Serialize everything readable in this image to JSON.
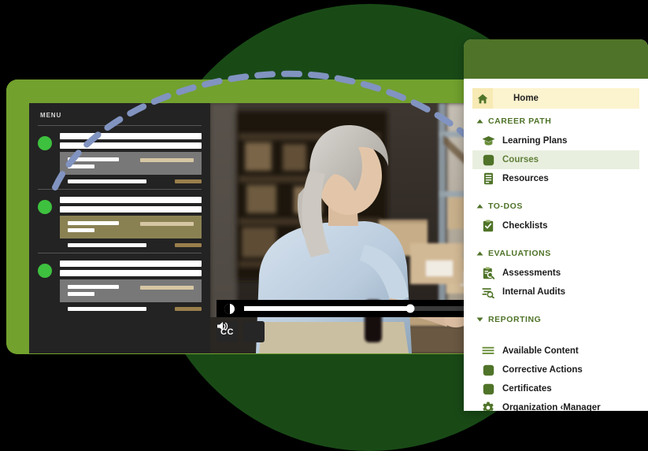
{
  "theme": {
    "brand_green": "#4f7328",
    "frame_green": "#618b2a",
    "circle_green": "#194a16",
    "accent_dot": "#3ec13e",
    "active_row_bg": "#e9efdf",
    "home_row_bg": "#fcf3cf",
    "dash_blue": "#8193c0",
    "panel_dark": "#232323"
  },
  "app_window": {
    "menu_panel": {
      "title": "MENU",
      "groups": [
        {
          "id": "group-1",
          "status": "complete",
          "card_style": "grey"
        },
        {
          "id": "group-2",
          "status": "complete",
          "card_style": "olive"
        },
        {
          "id": "group-3",
          "status": "complete",
          "card_style": "grey"
        }
      ]
    },
    "video_player": {
      "progress_percent": 62,
      "play_state": "playing",
      "controls": {
        "play_label": "",
        "cc_label": "CC",
        "volume_label": "◀"
      }
    }
  },
  "sidebar": {
    "home": {
      "label": "Home",
      "icon": "home-icon"
    },
    "sections": [
      {
        "label": "CAREER PATH",
        "expanded": true,
        "caret": "caret-up-icon",
        "items": [
          {
            "label": "Learning Plans",
            "icon": "graduation-cap-icon",
            "active": false
          },
          {
            "label": "Courses",
            "icon": "square-filled-icon",
            "active": true
          },
          {
            "label": "Resources",
            "icon": "book-icon",
            "active": false
          }
        ]
      },
      {
        "label": "TO-DOS",
        "expanded": true,
        "caret": "caret-up-icon",
        "items": [
          {
            "label": "Checklists",
            "icon": "clipboard-check-icon",
            "active": false
          }
        ]
      },
      {
        "label": "EVALUATIONS",
        "expanded": true,
        "caret": "caret-up-icon",
        "items": [
          {
            "label": "Assessments",
            "icon": "clipboard-search-icon",
            "active": false
          },
          {
            "label": "Internal Audits",
            "icon": "list-search-icon",
            "active": false
          }
        ]
      },
      {
        "label": "REPORTING",
        "expanded": false,
        "caret": "caret-down-icon",
        "items": [
          {
            "label": "Available Content",
            "icon": "list-lines-icon",
            "active": false
          },
          {
            "label": "Corrective Actions",
            "icon": "square-filled-icon",
            "active": false
          },
          {
            "label": "Certificates",
            "icon": "square-filled-icon",
            "active": false
          },
          {
            "label": "Organization ‹Manager",
            "icon": "gear-icon",
            "active": false
          }
        ]
      }
    ]
  }
}
